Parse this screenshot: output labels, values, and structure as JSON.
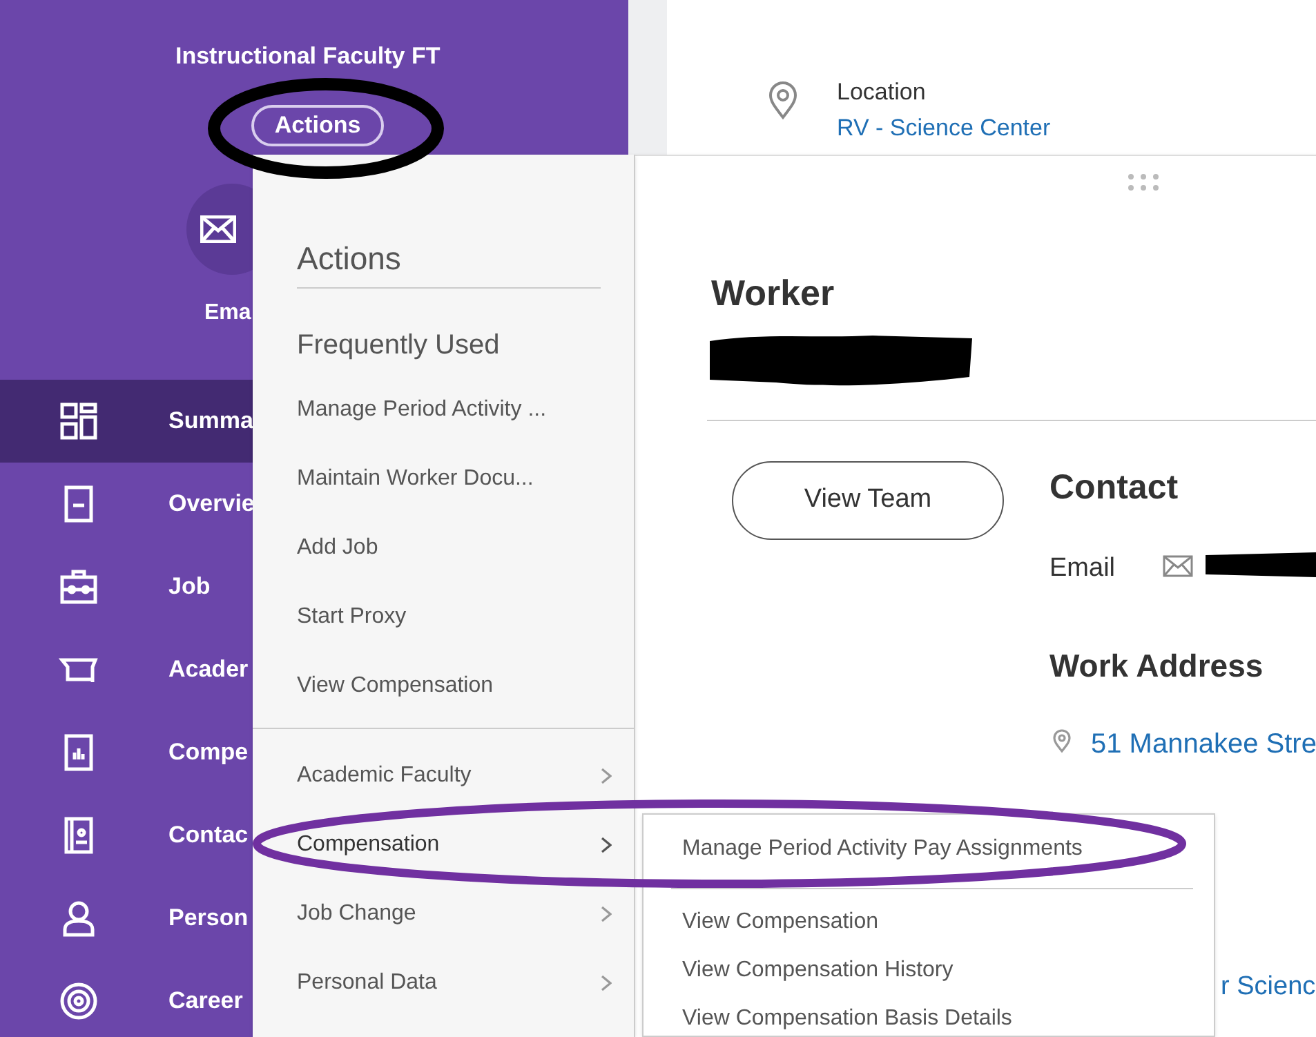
{
  "profile": {
    "subtitle": "Instructional Faculty FT",
    "actions_button": "Actions",
    "email_label": "Ema"
  },
  "sidebar": {
    "items": [
      {
        "label": "Summa",
        "selected": true
      },
      {
        "label": "Overvie",
        "selected": false
      },
      {
        "label": "Job",
        "selected": false
      },
      {
        "label": "Acader",
        "selected": false
      },
      {
        "label": "Compe",
        "selected": false
      },
      {
        "label": "Contac",
        "selected": false
      },
      {
        "label": "Person",
        "selected": false
      },
      {
        "label": "Career",
        "selected": false
      }
    ]
  },
  "location": {
    "label": "Location",
    "value": "RV - Science Center"
  },
  "actions_menu": {
    "title": "Actions",
    "section": "Frequently Used",
    "frequent": [
      "Manage Period Activity ...",
      "Maintain Worker Docu...",
      "Add Job",
      "Start Proxy",
      "View Compensation"
    ],
    "categories": [
      {
        "label": "Academic Faculty",
        "expanded": false
      },
      {
        "label": "Compensation",
        "expanded": true
      },
      {
        "label": "Job Change",
        "expanded": false
      },
      {
        "label": "Personal Data",
        "expanded": false
      }
    ]
  },
  "submenu": {
    "items": [
      "Manage Period Activity Pay Assignments",
      "View Compensation",
      "View Compensation History",
      "View Compensation Basis Details"
    ]
  },
  "worker_card": {
    "title": "Worker",
    "button": "View Team",
    "contact_heading": "Contact",
    "email_label": "Email",
    "work_address_heading": "Work Address",
    "address": "51 Mannakee Stre",
    "partial_link": "r Scienc"
  }
}
